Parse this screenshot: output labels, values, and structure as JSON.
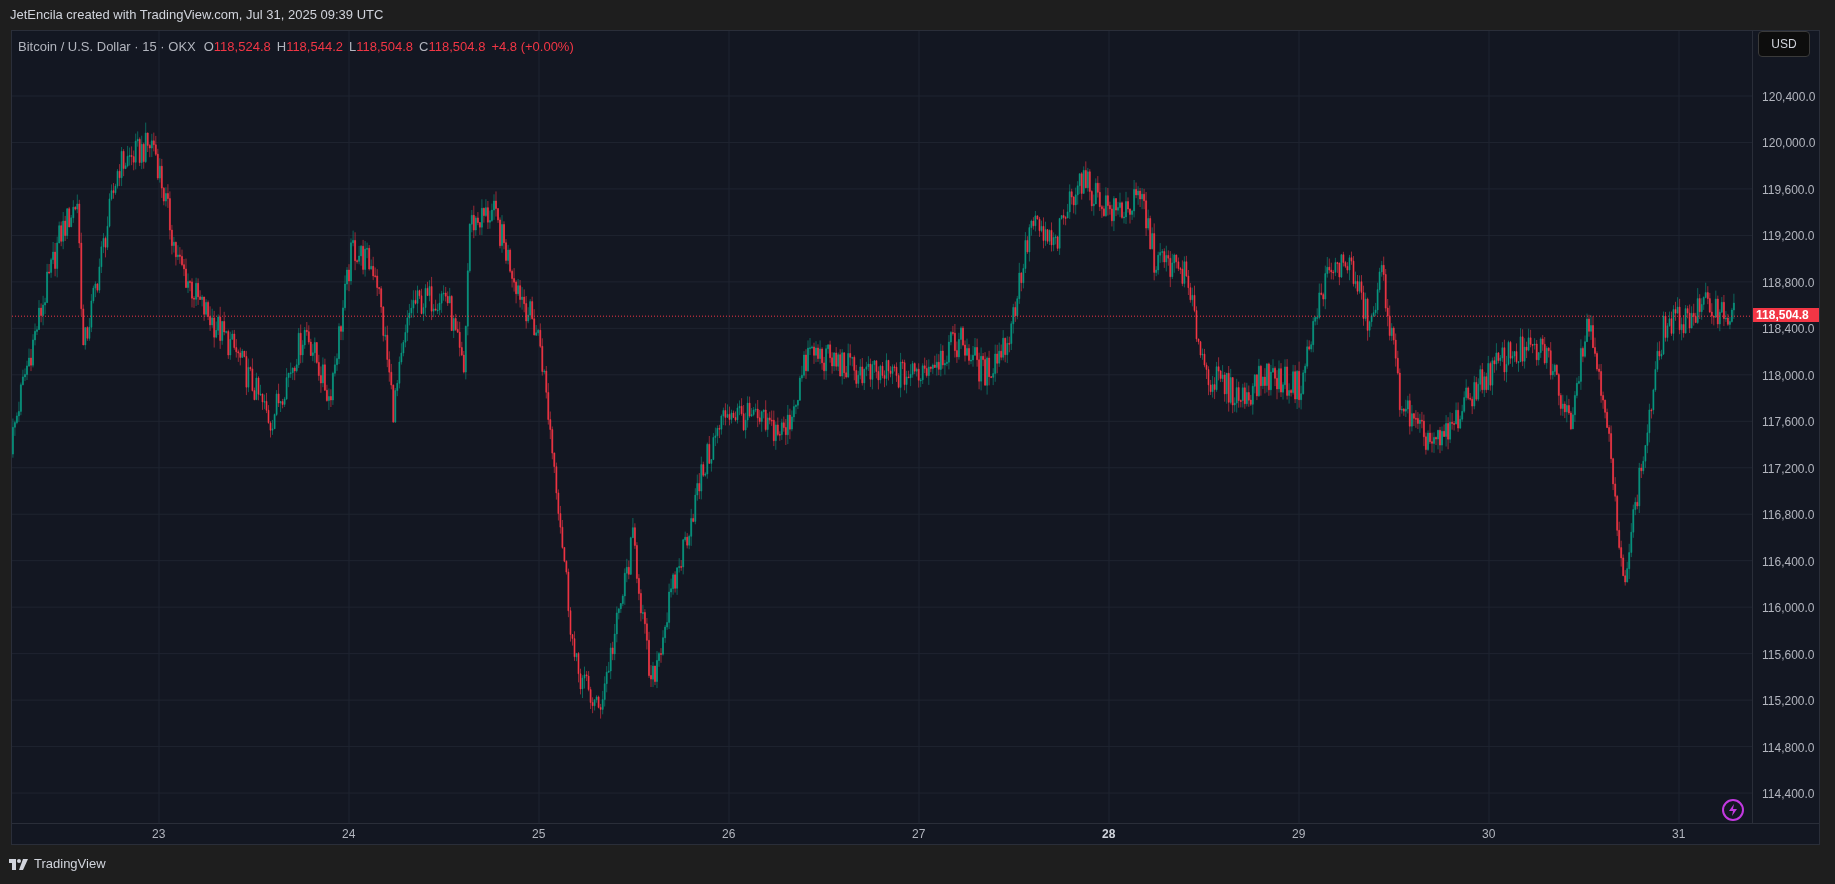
{
  "header": {
    "caption": "JetEncila created with TradingView.com, Jul 31, 2025 09:39 UTC"
  },
  "legend": {
    "symbol": "Bitcoin / U.S. Dollar · 15 · OKX",
    "ohlc": [
      {
        "label": "O",
        "value": "118,524.8"
      },
      {
        "label": "H",
        "value": "118,544.2"
      },
      {
        "label": "L",
        "value": "118,504.8"
      },
      {
        "label": "C",
        "value": "118,504.8"
      }
    ],
    "change": "+4.8 (+0.00%)"
  },
  "currency_button": "USD",
  "price_axis": [
    "120,400.0",
    "120,000.0",
    "119,600.0",
    "119,200.0",
    "118,800.0",
    "118,400.0",
    "118,000.0",
    "117,600.0",
    "117,200.0",
    "116,800.0",
    "116,400.0",
    "116,000.0",
    "115,600.0",
    "115,200.0",
    "114,800.0",
    "114,400.0"
  ],
  "last_price": "118,504.8",
  "time_axis": [
    {
      "label": "23",
      "emphasized": false
    },
    {
      "label": "24",
      "emphasized": false
    },
    {
      "label": "25",
      "emphasized": false
    },
    {
      "label": "26",
      "emphasized": false
    },
    {
      "label": "27",
      "emphasized": false
    },
    {
      "label": "28",
      "emphasized": true
    },
    {
      "label": "29",
      "emphasized": false
    },
    {
      "label": "30",
      "emphasized": false
    },
    {
      "label": "31",
      "emphasized": false
    }
  ],
  "footer": {
    "brand": "TradingView"
  }
}
